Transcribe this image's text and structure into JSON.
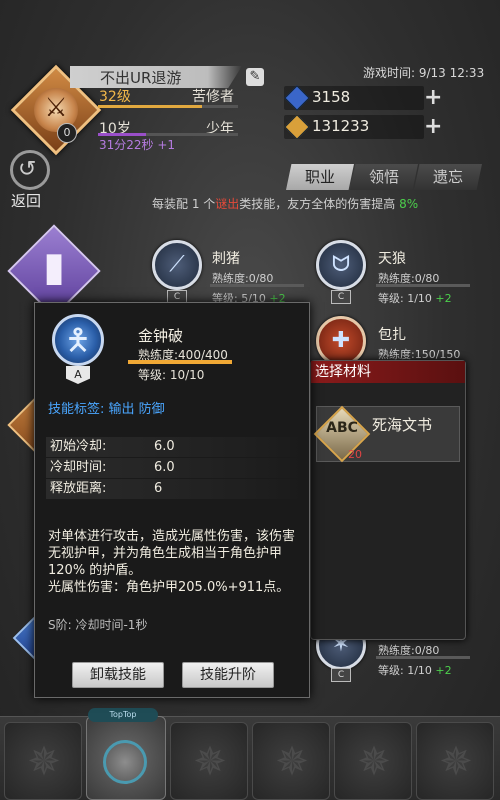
{
  "header": {
    "player_name": "不出UR退游",
    "level": "32级",
    "title": "苦修者",
    "age": "10岁",
    "stage": "少年",
    "timer": "31分22秒 +1",
    "avatar_level": "0",
    "game_time": "游戏时间: 9/13 12:33"
  },
  "resources": [
    {
      "icon": "blue-gem-icon",
      "value": "3158",
      "color": "#3a66c9"
    },
    {
      "icon": "gold-gem-icon",
      "value": "131233",
      "color": "#d9a03a"
    }
  ],
  "nav": {
    "back_label": "返回",
    "tabs": [
      {
        "label": "职业",
        "active": true
      },
      {
        "label": "领悟",
        "active": false
      },
      {
        "label": "遗忘",
        "active": false
      }
    ]
  },
  "bonus": {
    "prefix": "每装配 1 个",
    "highlight": "谜出",
    "suffix": "类技能，友方全体的伤害提高",
    "value": "8%"
  },
  "skills": [
    {
      "name": "刺猪",
      "prof": "熟练度:0/80",
      "lvl": "等级: 5/10",
      "plus": "+2",
      "grade": "C",
      "icon": "claw-icon"
    },
    {
      "name": "天狼",
      "prof": "熟练度:0/80",
      "lvl": "等级: 1/10",
      "plus": "+2",
      "grade": "C",
      "icon": "wolf-fang-icon"
    },
    {
      "name": "包扎",
      "prof": "熟练度:150/150",
      "icon": "bandage-icon"
    },
    {
      "prof": "熟练度:0/80",
      "lvl": "等级: 1/10",
      "plus": "+2",
      "grade": "C",
      "icon": "beast-icon"
    }
  ],
  "materials": {
    "header": "选择材料",
    "item_name": "死海文书",
    "item_count": "20",
    "item_glyph": "ABC"
  },
  "modal": {
    "skill_name": "金钟破",
    "grade": "A",
    "proficiency": "熟练度:400/400",
    "proficiency_pct": 100,
    "level": "等级: 10/10",
    "tags": "技能标签: 输出 防御",
    "stats": [
      {
        "label": "初始冷却:",
        "value": "6.0"
      },
      {
        "label": "冷却时间:",
        "value": "6.0"
      },
      {
        "label": "释放距离:",
        "value": "6"
      }
    ],
    "description": "对单体进行攻击，造成光属性伤害，该伤害无视护甲，并为角色生成相当于角色护甲 120% 的护盾。\n光属性伤害：角色护甲205.0%+911点。",
    "upgrade": "S阶: 冷却时间-1秒",
    "btn_unequip": "卸载技能",
    "btn_upgrade": "技能升阶"
  },
  "bottom": {
    "topup_label": "TopTop"
  },
  "colors": {
    "accent_gold": "#e2a93f",
    "accent_purple": "#9a4fc9",
    "tag_blue": "#4aa6ff",
    "positive_green": "#4ccf4c",
    "warning_red": "#e34a3a"
  }
}
